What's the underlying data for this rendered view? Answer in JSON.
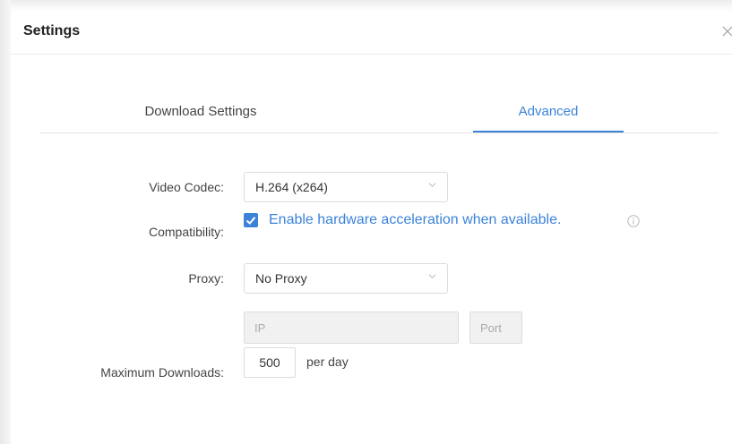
{
  "dialog": {
    "title": "Settings",
    "close_icon": "close-icon"
  },
  "tabs": [
    {
      "label": "Download Settings",
      "active": false
    },
    {
      "label": "Advanced",
      "active": true
    }
  ],
  "video_codec": {
    "label": "Video Codec:",
    "value": "H.264 (x264)"
  },
  "compatibility": {
    "label": "Compatibility:",
    "checkbox_label": "Enable hardware acceleration when available.",
    "checked": true,
    "info_icon": "info-icon"
  },
  "proxy": {
    "label": "Proxy:",
    "value": "No Proxy",
    "ip_placeholder": "IP",
    "port_placeholder": "Port"
  },
  "max_downloads": {
    "label": "Maximum Downloads:",
    "value": "500",
    "unit": "per day"
  },
  "colors": {
    "accent": "#3c83d8",
    "border": "#dcdcdc",
    "disabled_bg": "#f1f1f1"
  }
}
